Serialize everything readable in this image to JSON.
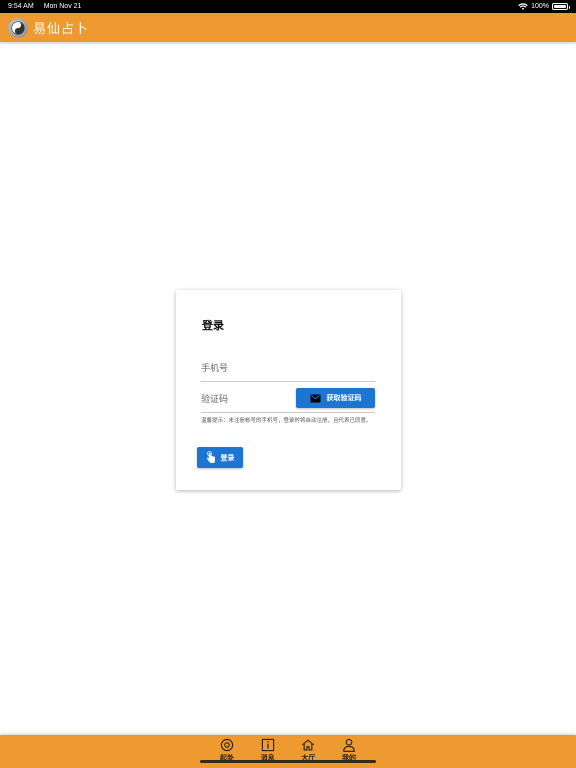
{
  "status_bar": {
    "time": "9:54 AM",
    "date": "Mon Nov 21",
    "battery": "100%",
    "battery_level": 1.0
  },
  "app_bar": {
    "title": "易仙占卜",
    "logo_icon": "yin-yang-logo-icon",
    "background_color": "#ef9a30"
  },
  "login": {
    "title": "登录",
    "phone_placeholder": "手机号",
    "code_placeholder": "验证码",
    "get_code_label": "获取验证码",
    "get_code_icon": "mail-icon",
    "notice": "温馨提示：未注册帐号的手机号，登录时将自动注册，且代表已同意。",
    "login_label": "登录",
    "login_icon": "touch-hand-icon",
    "accent_color": "#1c75d2"
  },
  "bottom_nav": {
    "items": [
      {
        "label": "起卦",
        "icon": "circle-target-icon"
      },
      {
        "label": "消息",
        "icon": "info-icon"
      },
      {
        "label": "大厅",
        "icon": "home-icon"
      },
      {
        "label": "我的",
        "icon": "person-icon"
      }
    ]
  }
}
